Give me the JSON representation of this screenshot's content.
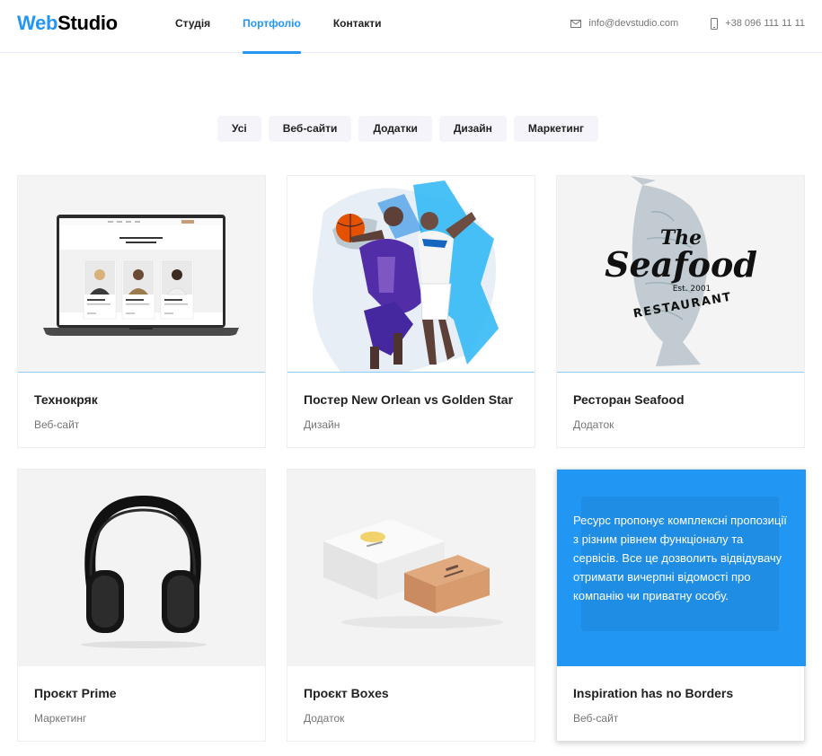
{
  "brand": {
    "part1": "Web",
    "part2": "Studio"
  },
  "nav": [
    {
      "label": "Студія"
    },
    {
      "label": "Портфоліо"
    },
    {
      "label": "Контакти"
    }
  ],
  "contacts": {
    "email": "info@devstudio.com",
    "phone": "+38 096 111 11 11"
  },
  "filters": [
    "Усі",
    "Веб-сайти",
    "Додатки",
    "Дизайн",
    "Маркетинг"
  ],
  "portfolio": [
    {
      "title": "Технокряк",
      "category": "Веб-сайт"
    },
    {
      "title": "Постер New Orlean vs Golden Star",
      "category": "Дизайн"
    },
    {
      "title": "Ресторан Seafood",
      "category": "Додаток",
      "logo": {
        "line1": "The",
        "line2": "Seafood",
        "line3": "Est. 2001",
        "line4": "RESTAURANT"
      }
    },
    {
      "title": "Проєкт Prime",
      "category": "Маркетинг"
    },
    {
      "title": "Проєкт Boxes",
      "category": "Додаток"
    },
    {
      "title": "Inspiration has no Borders",
      "category": "Веб-сайт",
      "overlay": "Ресурс пропонує комплексні пропозиції з різним рівнем функціоналу та сервісів. Все це дозволить відвідувачу отримати вичерпні відомості про компанію чи приватну особу."
    }
  ],
  "colors": {
    "accent": "#2196f3",
    "text": "#212121",
    "muted": "#757575",
    "filter_bg": "#f5f4fa"
  },
  "icons": {
    "email": "envelope-icon",
    "phone": "phone-icon"
  }
}
